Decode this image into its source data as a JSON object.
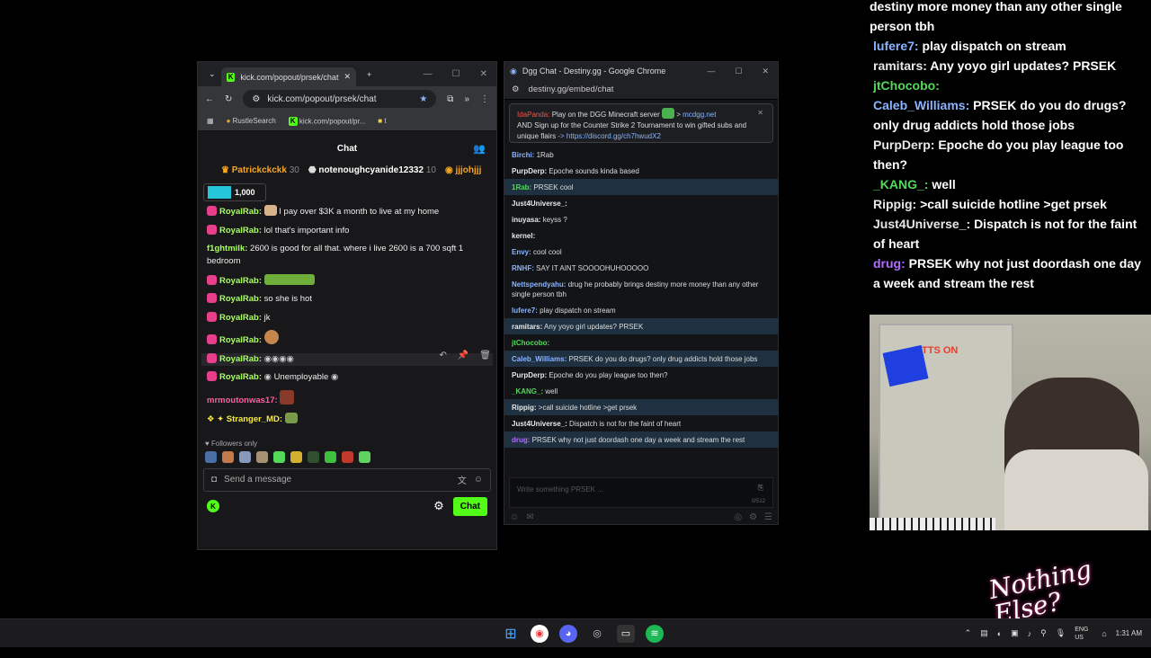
{
  "kick": {
    "tab_title": "kick.com/popout/prsek/chat",
    "url": "kick.com/popout/prsek/chat",
    "bookmarks": [
      "RustleSearch",
      "kick.com/popout/pr...",
      "t"
    ],
    "header": "Chat",
    "gifters": [
      {
        "name": "Patrickckckk",
        "count": "30"
      },
      {
        "name": "notenoughcyanide12332",
        "count": "10"
      },
      {
        "name": "jjjohjjj",
        "count": ""
      }
    ],
    "pill_value": "1,000",
    "messages": [
      {
        "user": "RoyalRab:",
        "text": "I pay over $3K a month to live at my home"
      },
      {
        "user": "RoyalRab:",
        "text": "lol that's important info"
      },
      {
        "user": "f1ghtmilk:",
        "text": "2600 is good for all that. where i live 2600 is a 700 sqft 1 bedroom"
      },
      {
        "user": "RoyalRab:",
        "text": ""
      },
      {
        "user": "RoyalRab:",
        "text": "so she is hot"
      },
      {
        "user": "RoyalRab:",
        "text": "jk"
      },
      {
        "user": "RoyalRab:",
        "text": ""
      },
      {
        "user": "RoyalRab:",
        "text": ""
      },
      {
        "user": "RoyalRab:",
        "text": "Unemployable"
      },
      {
        "user": "mrmoutonwas17:",
        "text": ""
      },
      {
        "user": "Stranger_MD:",
        "text": ""
      }
    ],
    "followers_only": "Followers only",
    "input_placeholder": "Send a message",
    "chat_button": "Chat"
  },
  "dgg": {
    "window_title": "Dgg Chat - Destiny.gg - Google Chrome",
    "url": "destiny.gg/embed/chat",
    "notice": {
      "user": "IdaPanda:",
      "text1": "Play on the DGG Minecraft server",
      "link1": "mcdgg.net",
      "text2": "AND Sign up for the Counter Strike 2 Tournament to win gifted subs and unique flairs",
      "link2": "-> https://discord.gg/ch7hwudX2"
    },
    "messages": [
      {
        "user": "Birchi:",
        "text": "1Rab",
        "color": "c-blue",
        "hl": false
      },
      {
        "user": "PurpDerp:",
        "text": "Epoche sounds kinda based",
        "color": "c-white",
        "hl": false
      },
      {
        "user": "1Rab:",
        "text": "PRSEK    cool",
        "color": "c-green",
        "hl": true
      },
      {
        "user": "Just4Universe_:",
        "text": "",
        "color": "c-white",
        "hl": false
      },
      {
        "user": "inuyasa:",
        "text": "keyss ?",
        "color": "c-white",
        "hl": false
      },
      {
        "user": "kernel:",
        "text": "",
        "color": "c-white",
        "hl": false
      },
      {
        "user": "Envy:",
        "text": "cool cool",
        "color": "c-blue",
        "hl": false
      },
      {
        "user": "RNHF:",
        "text": "SAY IT AINT SOOOOHUHOOOOO",
        "color": "c-blue",
        "hl": false
      },
      {
        "user": "Nettspendyahu:",
        "text": "drug he probably brings destiny more money than any other single person tbh",
        "color": "c-blue",
        "hl": false
      },
      {
        "user": "lufere7:",
        "text": "play dispatch on stream",
        "color": "c-blue",
        "hl": false
      },
      {
        "user": "ramitars:",
        "text": "Any yoyo girl updates? PRSEK",
        "color": "c-white",
        "hl": true
      },
      {
        "user": "jtChocobo:",
        "text": "",
        "color": "c-green",
        "hl": false
      },
      {
        "user": "Caleb_Williams:",
        "text": "PRSEK do you do drugs? only drug addicts hold those jobs",
        "color": "c-blue",
        "hl": true
      },
      {
        "user": "PurpDerp:",
        "text": "Epoche do you play league too then?",
        "color": "c-white",
        "hl": false
      },
      {
        "user": "_KANG_:",
        "text": "well",
        "color": "c-green",
        "hl": false
      },
      {
        "user": "Rippig:",
        "text": ">call suicide hotline >get prsek",
        "color": "c-white",
        "hl": true
      },
      {
        "user": "Just4Universe_:",
        "text": "Dispatch is not for the faint of heart",
        "color": "c-white",
        "hl": false
      },
      {
        "user": "drug:",
        "text": "PRSEK why not just doordash one day a week and stream the rest",
        "color": "c-purple",
        "hl": true
      }
    ],
    "input_placeholder": "Write something PRSEK ...",
    "char_count": "0/512"
  },
  "overlay": [
    {
      "user": "",
      "text": "destiny more money than any other single person tbh",
      "color": "o-white"
    },
    {
      "user": "lufere7:",
      "text": "play dispatch on stream",
      "color": "o-blue"
    },
    {
      "user": "ramitars:",
      "text": "Any yoyo girl updates? PRSEK",
      "color": "o-white"
    },
    {
      "user": "jtChocobo:",
      "text": "",
      "color": "o-green"
    },
    {
      "user": "Caleb_Williams:",
      "text": "PRSEK do you do drugs? only drug addicts hold those jobs",
      "color": "o-blue"
    },
    {
      "user": "PurpDerp:",
      "text": "Epoche do you play league too then?",
      "color": "o-white"
    },
    {
      "user": "_KANG_:",
      "text": "well",
      "color": "o-green"
    },
    {
      "user": "Rippig:",
      "text": ">call suicide hotline >get prsek",
      "color": "o-white"
    },
    {
      "user": "Just4Universe_:",
      "text": "Dispatch is not for the faint of heart",
      "color": "o-white"
    },
    {
      "user": "drug:",
      "text": "PRSEK why not just doordash one day a week and stream the rest",
      "color": "o-purple"
    }
  ],
  "webcam": {
    "sign_text": "TTS ON"
  },
  "logo_text": "Nothing Else?",
  "taskbar": {
    "lang": "ENG US",
    "time": "1:31 AM"
  }
}
